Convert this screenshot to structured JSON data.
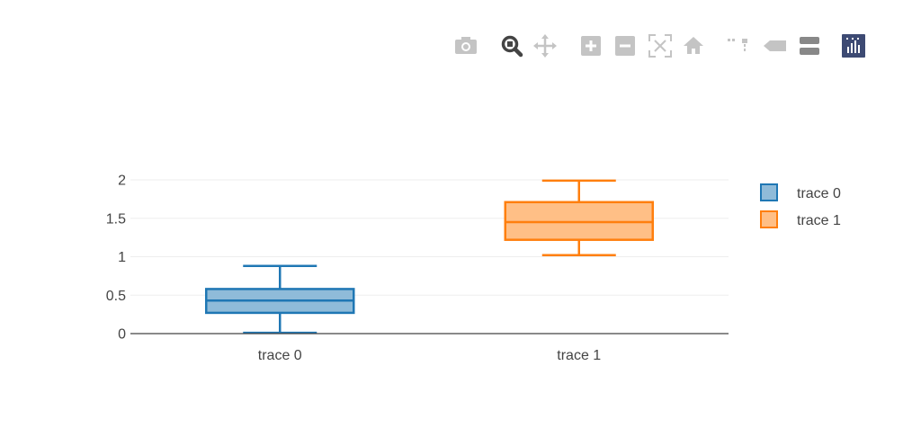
{
  "modebar": {
    "buttons": [
      {
        "name": "camera-icon",
        "active": false
      },
      {
        "name": "zoom-icon",
        "active": true
      },
      {
        "name": "pan-icon",
        "active": false
      },
      {
        "name": "zoom-in-icon",
        "active": false
      },
      {
        "name": "zoom-out-icon",
        "active": false
      },
      {
        "name": "autoscale-icon",
        "active": false
      },
      {
        "name": "home-icon",
        "active": false
      },
      {
        "name": "spike-lines-icon",
        "active": false
      },
      {
        "name": "hover-closest-icon",
        "active": false
      },
      {
        "name": "hover-compare-icon",
        "active": false
      },
      {
        "name": "plotly-logo-icon",
        "active": false
      }
    ],
    "colors": {
      "inactive": "#c4c4c4",
      "active": "#444444",
      "toggle": "#888888",
      "logo": "#3d4a73"
    }
  },
  "chart_data": {
    "type": "box",
    "categories": [
      "trace 0",
      "trace 1"
    ],
    "series": [
      {
        "name": "trace 0",
        "min": 0.01,
        "q1": 0.27,
        "median": 0.43,
        "q3": 0.58,
        "max": 0.88,
        "line_color": "#1f77b4",
        "fill_color": "#8fbbd9"
      },
      {
        "name": "trace 1",
        "min": 1.02,
        "q1": 1.22,
        "median": 1.45,
        "q3": 1.71,
        "max": 1.99,
        "line_color": "#ff7f0e",
        "fill_color": "#ffbf86"
      }
    ],
    "yticks": [
      {
        "value": 0,
        "label": "0"
      },
      {
        "value": 0.5,
        "label": "0.5"
      },
      {
        "value": 1,
        "label": "1"
      },
      {
        "value": 1.5,
        "label": "1.5"
      },
      {
        "value": 2,
        "label": "2"
      }
    ],
    "ylim": [
      0,
      2.1
    ],
    "grid": true,
    "legend_position": "right",
    "title": "",
    "xlabel": "",
    "ylabel": ""
  }
}
